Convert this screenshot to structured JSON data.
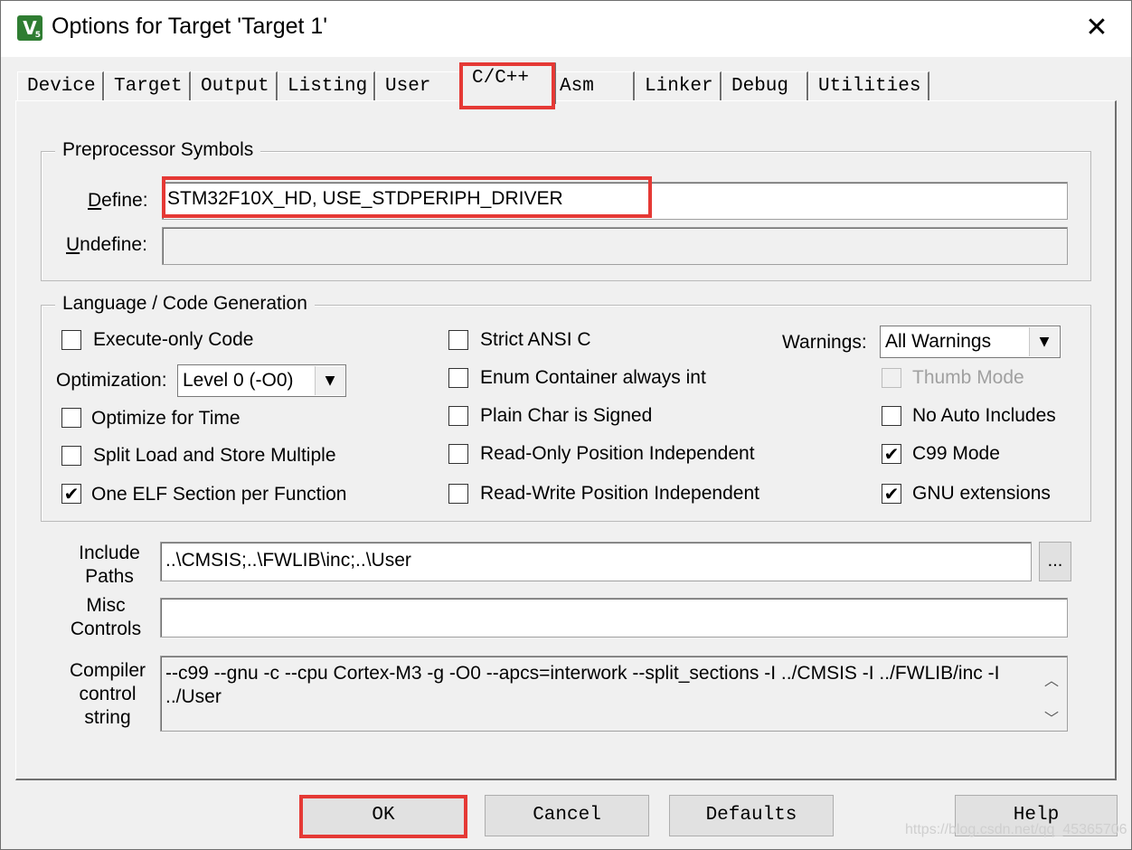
{
  "window": {
    "title": "Options for Target 'Target 1'",
    "app_icon": "keil-uvision-icon",
    "close_glyph": "✕"
  },
  "tabs": [
    {
      "label": "Device"
    },
    {
      "label": "Target"
    },
    {
      "label": "Output"
    },
    {
      "label": "Listing"
    },
    {
      "label": "User"
    },
    {
      "label": "C/C++",
      "active": true
    },
    {
      "label": "Asm"
    },
    {
      "label": "Linker"
    },
    {
      "label": "Debug"
    },
    {
      "label": "Utilities"
    }
  ],
  "preprocessor": {
    "legend": "Preprocessor Symbols",
    "define_label": "Define:",
    "define_value": "STM32F10X_HD, USE_STDPERIPH_DRIVER",
    "undefine_label": "Undefine:",
    "undefine_value": ""
  },
  "language": {
    "legend": "Language / Code Generation",
    "execute_only": {
      "label": "Execute-only Code",
      "checked": false
    },
    "optimization_label": "Optimization:",
    "optimization_value": "Level 0 (-O0)",
    "optimize_time": {
      "label": "Optimize for Time",
      "checked": false
    },
    "split_load": {
      "label": "Split Load and Store Multiple",
      "checked": false
    },
    "one_elf": {
      "label": "One ELF Section per Function",
      "checked": true
    },
    "strict_ansi": {
      "label": "Strict ANSI C",
      "checked": false
    },
    "enum_container": {
      "label": "Enum Container always int",
      "checked": false
    },
    "plain_char": {
      "label": "Plain Char is Signed",
      "checked": false
    },
    "ro_pos": {
      "label": "Read-Only Position Independent",
      "checked": false
    },
    "rw_pos": {
      "label": "Read-Write Position Independent",
      "checked": false
    },
    "warnings_label": "Warnings:",
    "warnings_value": "All Warnings",
    "thumb_mode": {
      "label": "Thumb Mode",
      "checked": false,
      "disabled": true
    },
    "no_auto_includes": {
      "label": "No Auto Includes",
      "checked": false
    },
    "c99_mode": {
      "label": "C99 Mode",
      "checked": true
    },
    "gnu_ext": {
      "label": "GNU extensions",
      "checked": true
    }
  },
  "paths": {
    "include_label_1": "Include",
    "include_label_2": "Paths",
    "include_value": "..\\CMSIS;..\\FWLIB\\inc;..\\User",
    "browse_label": "...",
    "misc_label_1": "Misc",
    "misc_label_2": "Controls",
    "misc_value": "",
    "compiler_label_1": "Compiler",
    "compiler_label_2": "control",
    "compiler_label_3": "string",
    "compiler_value": "--c99 --gnu -c --cpu Cortex-M3 -g -O0 --apcs=interwork --split_sections -I ../CMSIS -I ../FWLIB/inc -I ../User"
  },
  "buttons": {
    "ok": "OK",
    "cancel": "Cancel",
    "defaults": "Defaults",
    "help": "Help"
  },
  "watermark": "https://blog.csdn.net/qq_45365706",
  "highlight_color": "#e53935"
}
